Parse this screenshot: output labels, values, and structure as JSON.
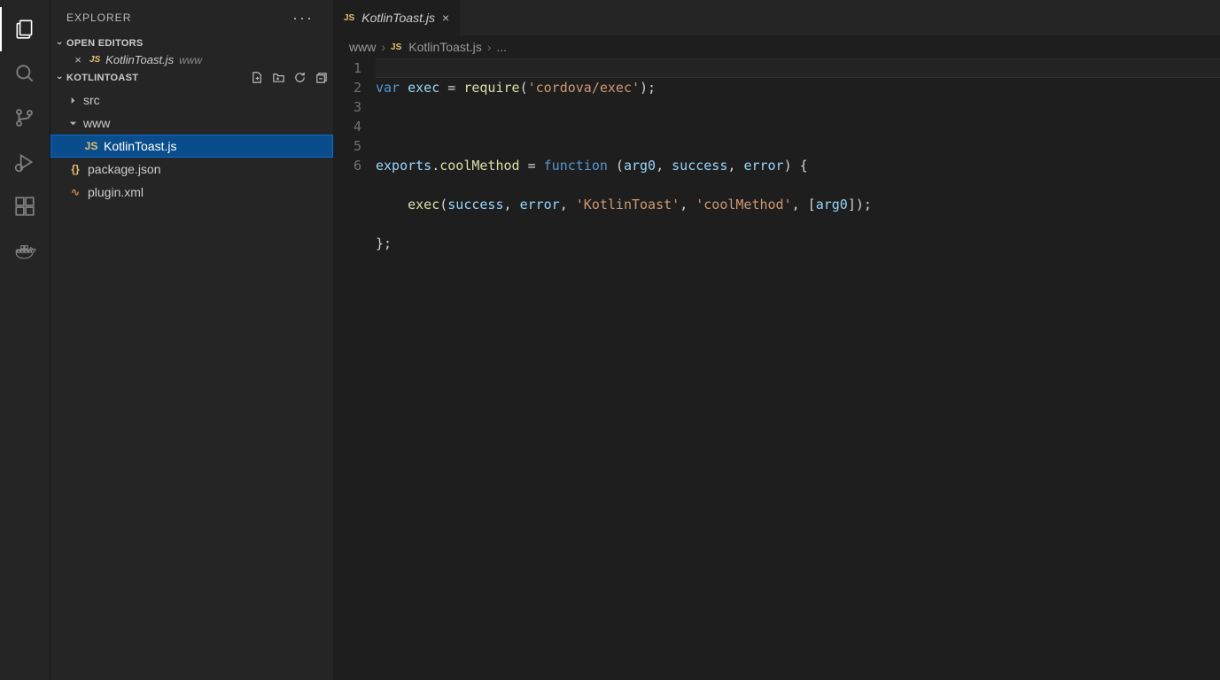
{
  "sidebarTitle": "EXPLORER",
  "openEditorsHdr": "OPEN EDITORS",
  "openEditorFile": "KotlinToast.js",
  "openEditorFolder": "www",
  "workspaceName": "KOTLINTOAST",
  "tree": {
    "src": "src",
    "www": "www",
    "kotlinjs": "KotlinToast.js",
    "pkg": "package.json",
    "plugin": "plugin.xml"
  },
  "tabName": "KotlinToast.js",
  "crumbs": {
    "c1": "www",
    "c2": "KotlinToast.js",
    "c3": "..."
  },
  "code": {
    "l1": {
      "a": "var",
      "b": " exec ",
      "c": "=",
      "d": " require",
      "e": "(",
      "f": "'cordova/exec'",
      "g": ");"
    },
    "l3": {
      "a": "exports",
      "b": ".",
      "c": "coolMethod",
      "d": " = ",
      "e": "function",
      "f": " (",
      "g": "arg0",
      "h": ", ",
      "i": "success",
      "j": ", ",
      "k": "error",
      "l": ") {"
    },
    "l4": {
      "a": "    exec",
      "b": "(",
      "c": "success",
      "d": ", ",
      "e": "error",
      "f": ", ",
      "g": "'KotlinToast'",
      "h": ", ",
      "i": "'coolMethod'",
      "j": ", [",
      "k": "arg0",
      "l": "]);"
    },
    "l5": "};",
    "nums": {
      "1": "1",
      "2": "2",
      "3": "3",
      "4": "4",
      "5": "5",
      "6": "6"
    }
  }
}
